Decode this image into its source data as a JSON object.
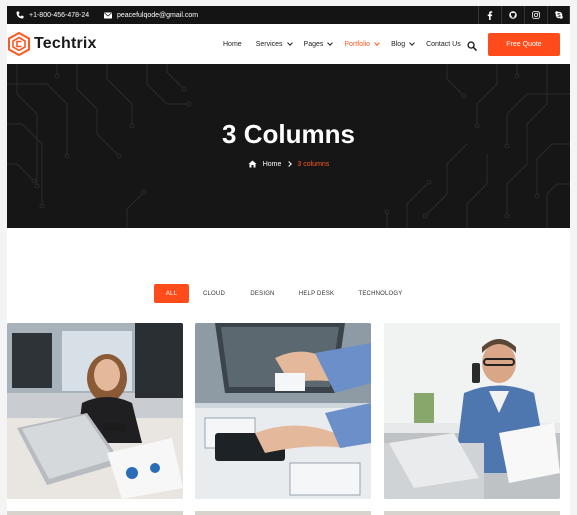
{
  "topbar": {
    "phone": "+1-800-456-478-24",
    "email": "peacefulqode@gmail.com",
    "social_icons": [
      "facebook-icon",
      "github-icon",
      "instagram-icon",
      "skype-icon"
    ]
  },
  "header": {
    "logo_text": "Techtrix",
    "nav": [
      {
        "label": "Home",
        "dropdown": false,
        "active": false
      },
      {
        "label": "Services",
        "dropdown": true,
        "active": false
      },
      {
        "label": "Pages",
        "dropdown": true,
        "active": false
      },
      {
        "label": "Portfolio",
        "dropdown": true,
        "active": true
      },
      {
        "label": "Blog",
        "dropdown": true,
        "active": false
      },
      {
        "label": "Contact Us",
        "dropdown": false,
        "active": false
      }
    ],
    "cta_label": "Free Quote"
  },
  "hero": {
    "title": "3 Columns",
    "breadcrumb_home": "Home",
    "breadcrumb_current": "3 columns"
  },
  "filters": [
    "ALL",
    "CLOUD",
    "DESIGN",
    "HELP DESK",
    "TECHNOLOGY"
  ],
  "active_filter": "ALL",
  "colors": {
    "accent": "#ff4c1a",
    "dark": "#141414",
    "hero_bg": "#161616"
  }
}
